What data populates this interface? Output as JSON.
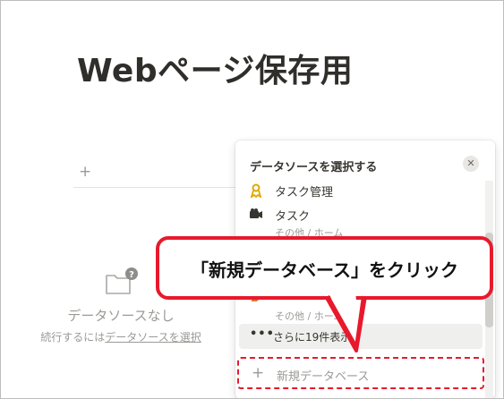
{
  "page": {
    "title": "Webページ保存用",
    "empty_title": "データソースなし",
    "empty_sub_prefix": "続行するには",
    "empty_sub_link": "データソースを選択"
  },
  "popup": {
    "header": "データソースを選択する",
    "close_label": "✕",
    "items": [
      {
        "icon": "ribbon-icon",
        "label": "タスク管理",
        "sub": ""
      },
      {
        "icon": "camera-icon",
        "label": "タスク",
        "sub": "その他 / ホーム"
      },
      {
        "icon": "tag-icon",
        "label": "",
        "sub": "その他 / ホーム"
      }
    ],
    "more_label": "さらに19件表示",
    "new_db_label": "新規データベース"
  },
  "callout": {
    "text": "「新規データベース」をクリック"
  },
  "colors": {
    "accent": "#e8192c",
    "muted_text": "#9b9a97",
    "text": "#37352f"
  }
}
